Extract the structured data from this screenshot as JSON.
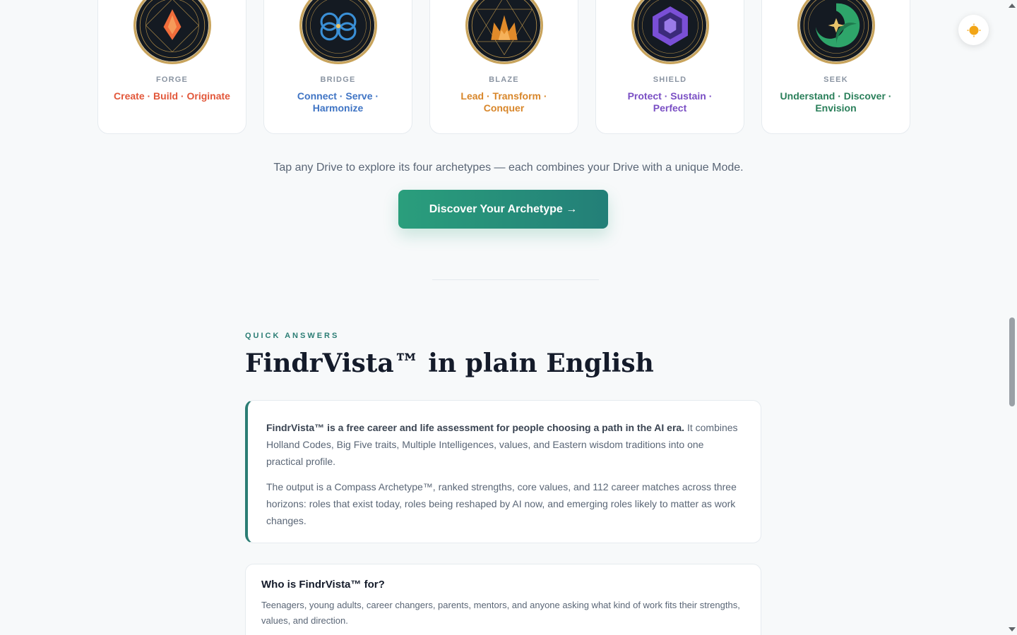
{
  "drives": [
    {
      "name": "FORGE",
      "verbs": "Create · Build · Originate",
      "color": "#e2573a",
      "icon": "diamond-flame-icon",
      "accent": "#f06c3a"
    },
    {
      "name": "BRIDGE",
      "verbs": "Connect · Serve · Harmonize",
      "color": "#3f74c4",
      "icon": "infinity-knot-icon",
      "accent": "#3a8fd6"
    },
    {
      "name": "BLAZE",
      "verbs": "Lead · Transform · Conquer",
      "color": "#d8862a",
      "icon": "crown-flame-icon",
      "accent": "#e08a2a"
    },
    {
      "name": "SHIELD",
      "verbs": "Protect · Sustain · Perfect",
      "color": "#7a4fc4",
      "icon": "hexagon-shield-icon",
      "accent": "#7a4fd6"
    },
    {
      "name": "SEEK",
      "verbs": "Understand · Discover · Envision",
      "color": "#2a7f5a",
      "icon": "star-swirl-icon",
      "accent": "#2ea56a"
    }
  ],
  "tap_text": "Tap any Drive to explore its four archetypes — each combines your Drive with a unique Mode.",
  "cta": {
    "label": "Discover Your Archetype →"
  },
  "quick_answers": {
    "eyebrow": "QUICK ANSWERS",
    "title": "FindrVista™ in plain English",
    "lead_bold": "FindrVista™ is a free career and life assessment for people choosing a path in the AI era.",
    "lead_rest": " It combines Holland Codes, Big Five traits, Multiple Intelligences, values, and Eastern wisdom traditions into one practical profile.",
    "para2": "The output is a Compass Archetype™, ranked strengths, core values, and 112 career matches across three horizons: roles that exist today, roles being reshaped by AI now, and emerging roles likely to matter as work changes."
  },
  "faq": {
    "question": "Who is FindrVista™ for?",
    "answer": "Teenagers, young adults, career changers, parents, mentors, and anyone asking what kind of work fits their strengths, values, and direction."
  },
  "theme_toggle": {
    "icon": "sun-icon",
    "color": "#f2a516"
  }
}
